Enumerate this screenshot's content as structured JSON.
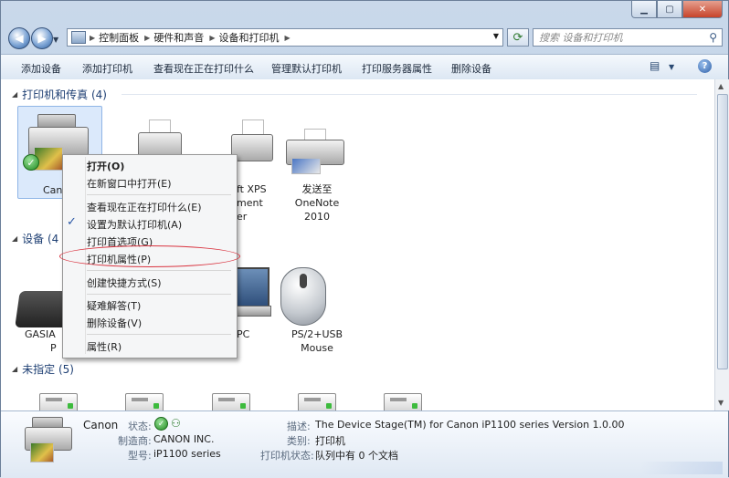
{
  "breadcrumb": {
    "items": [
      "控制面板",
      "硬件和声音",
      "设备和打印机"
    ]
  },
  "search": {
    "placeholder": "搜索 设备和打印机"
  },
  "toolbar": {
    "items": [
      "添加设备",
      "添加打印机",
      "查看现在正在打印什么",
      "管理默认打印机",
      "打印服务器属性",
      "删除设备"
    ]
  },
  "groups": {
    "printers": "打印机和传真 (4)",
    "devices": "设备 (4",
    "unspecified": "未指定 (5)"
  },
  "printers": [
    {
      "name": "Can"
    },
    {
      "name": ""
    },
    {
      "name_lines": [
        "ft XPS",
        "ment",
        "er"
      ]
    },
    {
      "name_lines": [
        "发送至 OneNote",
        "2010"
      ]
    }
  ],
  "devices": [
    {
      "name_lines": [
        "GASIA",
        "P"
      ]
    },
    {
      "name_lines": [
        "PC"
      ]
    },
    {
      "name_lines": [
        "PS/2+USB",
        "Mouse"
      ]
    }
  ],
  "context_menu": {
    "items": [
      {
        "label": "打开(O)",
        "bold": true
      },
      {
        "label": "在新窗口中打开(E)"
      },
      {
        "label": "查看现在正在打印什么(E)"
      },
      {
        "label": "设置为默认打印机(A)",
        "checked": true
      },
      {
        "label": "打印首选项(G)"
      },
      {
        "label": "打印机属性(P)",
        "highlighted": true
      },
      {
        "label": "创建快捷方式(S)"
      },
      {
        "label": "疑难解答(T)"
      },
      {
        "label": "删除设备(V)"
      },
      {
        "label": "属性(R)"
      }
    ]
  },
  "details": {
    "name": "Canon",
    "status_label": "状态:",
    "manufacturer_label": "制造商:",
    "manufacturer": "CANON INC.",
    "model_label": "型号:",
    "model": "iP1100 series",
    "description_label": "描述:",
    "description": "The Device Stage(TM) for Canon iP1100 series Version 1.0.00",
    "category_label": "类别:",
    "category": "打印机",
    "printer_status_label": "打印机状态:",
    "printer_status": "队列中有 0 个文档"
  },
  "colors": {
    "accent": "#1e3f73",
    "selection": "#dbe9fb",
    "annotation": "#d9333f"
  }
}
